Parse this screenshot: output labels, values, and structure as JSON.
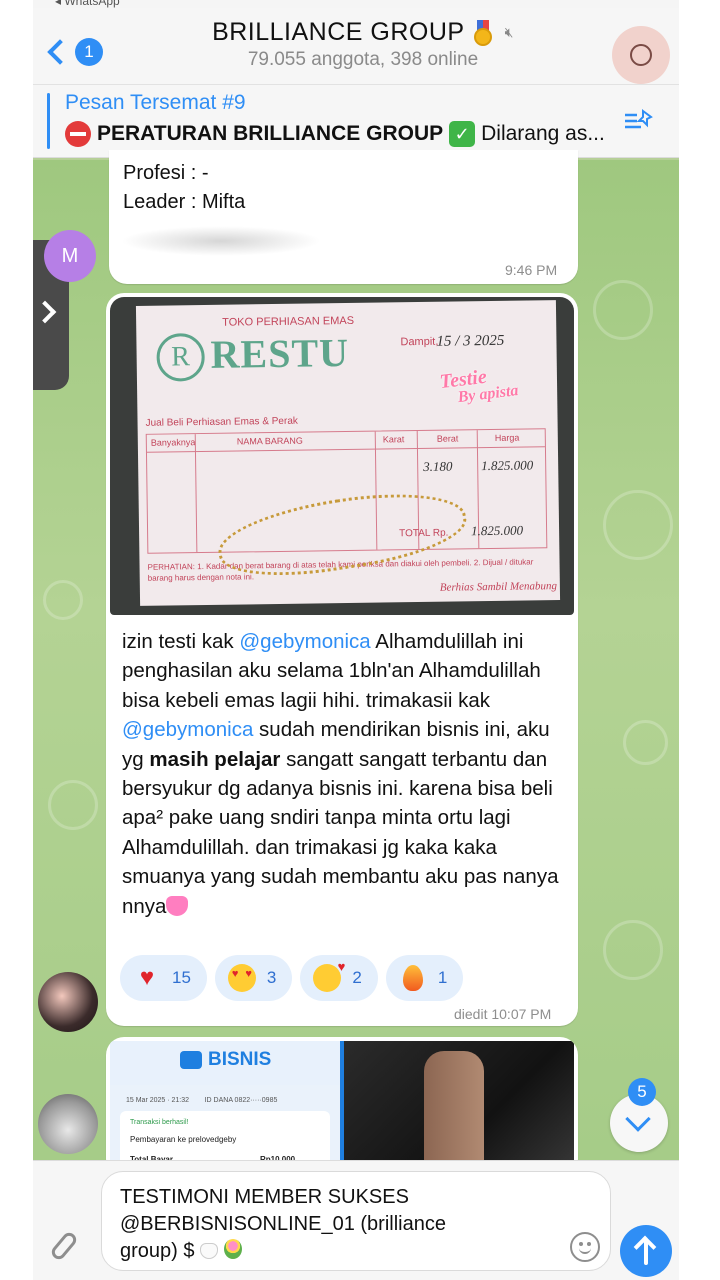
{
  "status_bar": {
    "back_app": "◂ WhatsApp"
  },
  "header": {
    "back_badge": "1",
    "title": "BRILLIANCE GROUP",
    "subtitle": "79.055 anggota, 398 online"
  },
  "pinned": {
    "title": "Pesan Tersemat #9",
    "text": "PERATURAN BRILLIANCE GROUP",
    "text_suffix": "Dilarang as..."
  },
  "messages": [
    {
      "lines": [
        "Profesi : -",
        "Leader : Mifta"
      ],
      "time": "9:46 PM",
      "sender_initial": "M"
    },
    {
      "receipt": {
        "shop": "TOKO PERHIASAN EMAS",
        "name": "RESTU",
        "logo": "R",
        "subtitle": "Jual Beli Perhiasan Emas & Perak",
        "date_label": "Dampit,",
        "date_value": "15 / 3 2025",
        "columns": [
          "Banyaknya",
          "NAMA BARANG",
          "Karat",
          "Berat",
          "Harga"
        ],
        "weight": "3.180",
        "price": "1.825.000",
        "total_label": "TOTAL Rp.",
        "total_value": "1.825.000",
        "footer": "PERHATIAN: 1. Kadar dan berat barang di atas telah kami periksa dan diakui oleh pembeli. 2. Dijual / ditukar barang harus dengan nota ini.",
        "slogan": "Berhias Sambil Menabung",
        "stamp_line1": "Testie",
        "stamp_line2": "By apista"
      },
      "text_parts": {
        "p1": "izin testi kak ",
        "m1": "@gebymonica",
        "p2": " Alhamdulillah ini penghasilan aku selama 1bln'an Alhamdulillah bisa kebeli emas lagii hihi. trimakasii kak ",
        "m2": "@gebymonica",
        "p3": " sudah mendirikan bisnis ini, aku yg ",
        "b1": "masih pelajar",
        "p4": " sangatt sangatt terbantu dan bersyukur dg adanya bisnis ini. karena bisa beli apa² pake uang sndiri tanpa minta ortu lagi Alhamdulillah. dan trimakasi jg kaka kaka smuanya yang sudah membantu aku pas nanya nnya"
      },
      "reactions": [
        {
          "icon": "red-heart",
          "count": "15"
        },
        {
          "icon": "heart-eyes-face",
          "count": "3"
        },
        {
          "icon": "smiling-face-with-hearts",
          "count": "2"
        },
        {
          "icon": "fire",
          "count": "1"
        }
      ],
      "time": "diedit 10:07 PM"
    },
    {
      "screenshot": {
        "brand": "BISNIS",
        "meta_date": "15 Mar 2025 · 21:32",
        "meta_id": "ID DANA 0822·····0985",
        "status": "Transaksi berhasil!",
        "payment_to": "Pembayaran ke prelovedgeby",
        "total_label": "Total Bayar",
        "total_value": "Rp10.000"
      }
    }
  ],
  "scroll_badge": "5",
  "composer": {
    "text_line1": "TESTIMONI MEMBER SUKSES",
    "text_line2": "@BERBISNISONLINE_01 (brilliance",
    "text_line3": "group) $"
  },
  "colors": {
    "accent": "#2f8ef5",
    "chat_bg": "#a6cc88",
    "reaction_bg": "#e4effc",
    "bubble": "#ffffff"
  }
}
